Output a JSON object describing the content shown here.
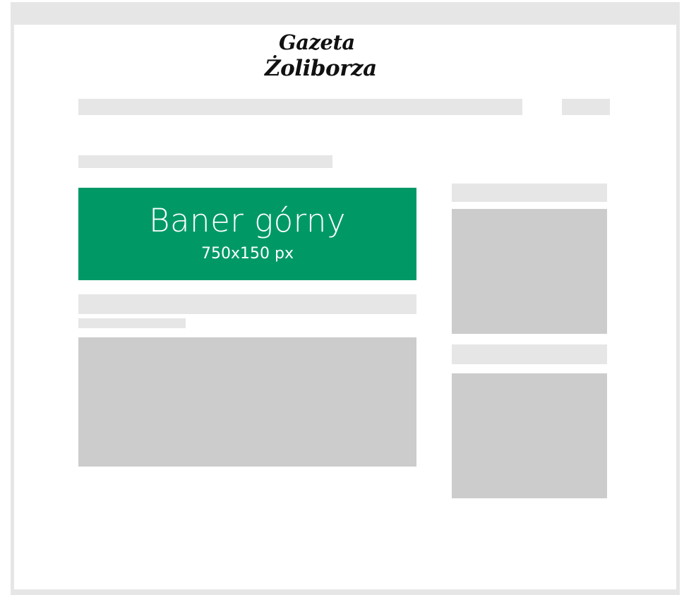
{
  "logo": {
    "line1": "Gazeta",
    "line2": "Żoliborza"
  },
  "banner": {
    "title": "Baner górny",
    "size": "750x150 px"
  },
  "colors": {
    "banner_bg": "#009966",
    "placeholder_light": "#e6e6e6",
    "placeholder_dark": "#cccccc"
  }
}
